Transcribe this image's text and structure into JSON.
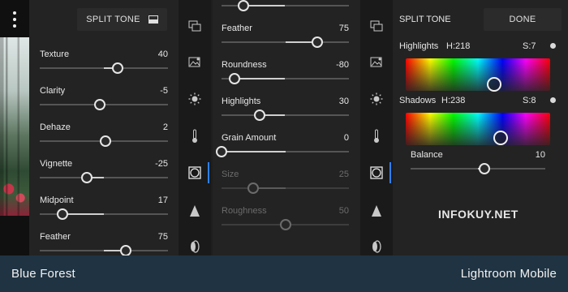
{
  "panel_a": {
    "header_button": {
      "label": "SPLIT TONE",
      "icon": "panel-toggle-icon"
    },
    "sliders": [
      {
        "label": "Texture",
        "value": "40",
        "position": 0.61
      },
      {
        "label": "Clarity",
        "value": "-5",
        "position": 0.47
      },
      {
        "label": "Dehaze",
        "value": "2",
        "position": 0.51
      },
      {
        "label": "Vignette",
        "value": "-25",
        "position": 0.37
      },
      {
        "label": "Midpoint",
        "value": "17",
        "position": 0.18
      },
      {
        "label": "Feather",
        "value": "75",
        "position": 0.67
      }
    ]
  },
  "panel_b": {
    "sliders": [
      {
        "label": "",
        "value": "",
        "position": 0.17
      },
      {
        "label": "Feather",
        "value": "75",
        "position": 0.75
      },
      {
        "label": "Roundness",
        "value": "-80",
        "position": 0.1
      },
      {
        "label": "Highlights",
        "value": "30",
        "position": 0.3
      },
      {
        "label": "Grain Amount",
        "value": "0",
        "position": 0.0
      },
      {
        "label": "Size",
        "value": "25",
        "position": 0.25,
        "disabled": true
      },
      {
        "label": "Roughness",
        "value": "50",
        "position": 0.5,
        "disabled": true
      }
    ]
  },
  "panel_c": {
    "title": "SPLIT TONE",
    "done_label": "DONE",
    "highlights": {
      "label": "Highlights",
      "hue": "H:218",
      "sat": "S:7",
      "hue_fraction": 0.61,
      "sat_fraction": 0.07
    },
    "shadows": {
      "label": "Shadows",
      "hue": "H:238",
      "sat": "S:8",
      "hue_fraction": 0.66,
      "sat_fraction": 0.08
    },
    "balance": {
      "label": "Balance",
      "value": "10",
      "position": 0.55
    }
  },
  "toolbar_icons": [
    "layers-icon",
    "image-edit-icon",
    "light-sun-icon",
    "color-thermometer-icon",
    "effects-vignette-icon",
    "detail-triangle-icon",
    "optics-lens-icon"
  ],
  "watermark": "INFOKUY.NET",
  "footer": {
    "left": "Blue Forest",
    "right": "Lightroom Mobile"
  },
  "colors": {
    "accent": "#2f80ff",
    "footer_bg": "#1f3342"
  }
}
